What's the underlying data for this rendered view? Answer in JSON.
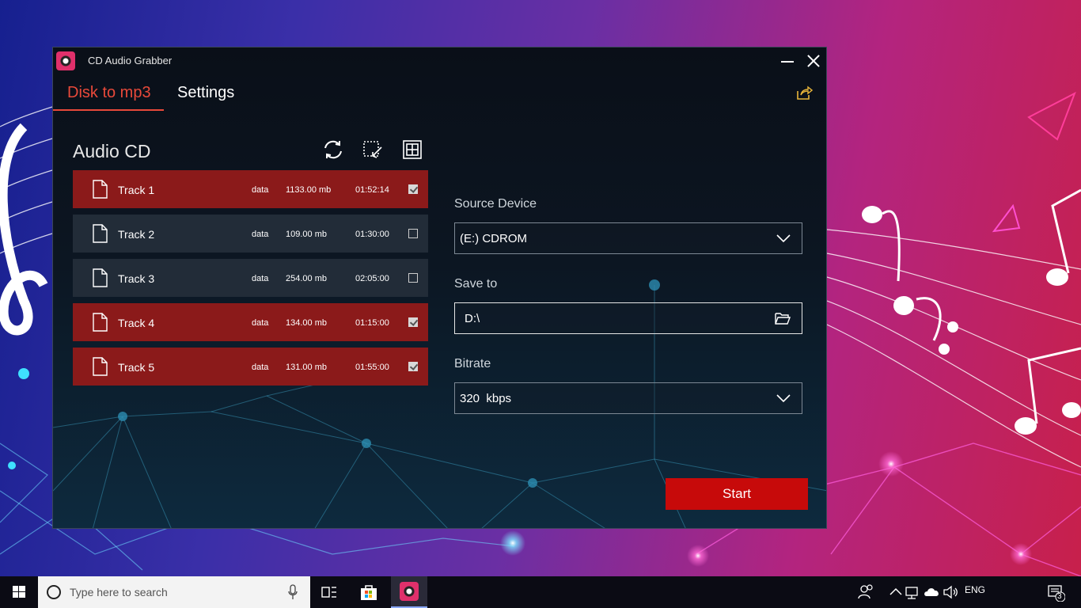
{
  "window": {
    "title": "CD Audio Grabber",
    "tabs": [
      {
        "label": "Disk to mp3",
        "active": true
      },
      {
        "label": "Settings",
        "active": false
      }
    ]
  },
  "cd": {
    "title": "Audio CD",
    "tracks": [
      {
        "name": "Track 1",
        "type": "data",
        "size": "1133.00 mb",
        "duration": "01:52:14",
        "checked": true
      },
      {
        "name": "Track 2",
        "type": "data",
        "size": "109.00 mb",
        "duration": "01:30:00",
        "checked": false
      },
      {
        "name": "Track 3",
        "type": "data",
        "size": "254.00 mb",
        "duration": "02:05:00",
        "checked": false
      },
      {
        "name": "Track 4",
        "type": "data",
        "size": "134.00 mb",
        "duration": "01:15:00",
        "checked": true
      },
      {
        "name": "Track 5",
        "type": "data",
        "size": "131.00 mb",
        "duration": "01:55:00",
        "checked": true
      }
    ]
  },
  "form": {
    "source_label": "Source Device",
    "source_value": "(E:) CDROM",
    "save_label": "Save to",
    "save_value": "D:\\",
    "bitrate_label": "Bitrate",
    "bitrate_value": "320  kbps",
    "start_label": "Start"
  },
  "taskbar": {
    "search_placeholder": "Type here to search",
    "language": "ENG",
    "notification_count": "3"
  },
  "icons": {
    "toolbar": [
      "refresh-icon",
      "select-all-icon",
      "grid-icon"
    ],
    "share": "share-icon"
  },
  "colors": {
    "accent": "#e8493a",
    "checked_row": "#8b1a1a",
    "unchecked_row": "#222c38",
    "start_button": "#c70a0a"
  }
}
